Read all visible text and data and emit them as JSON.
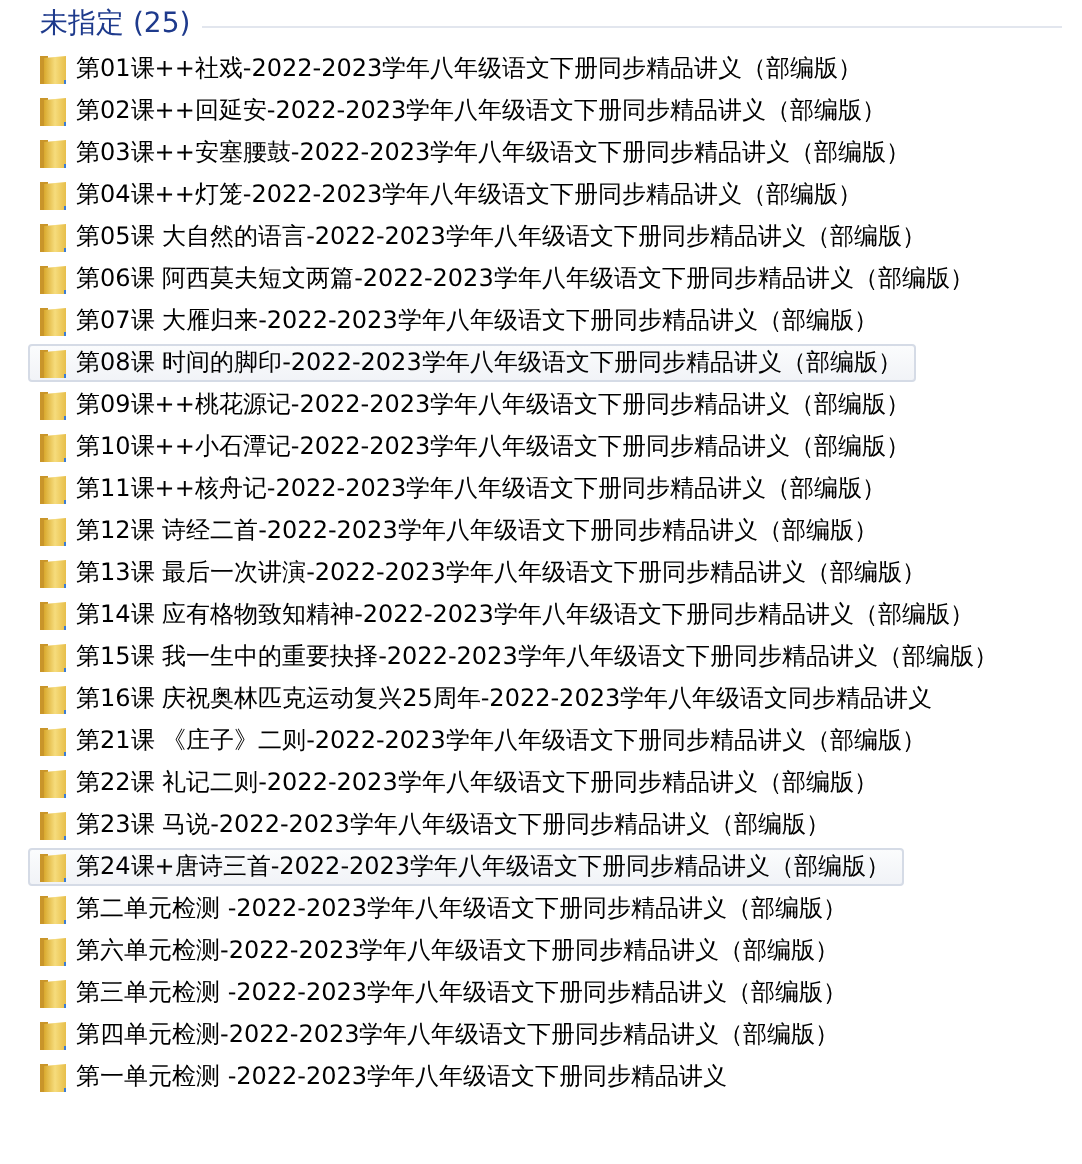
{
  "group": {
    "title": "未指定 (25)"
  },
  "items": [
    {
      "name": "第01课++社戏-2022-2023学年八年级语文下册同步精品讲义（部编版）",
      "selected": false
    },
    {
      "name": "第02课++回延安-2022-2023学年八年级语文下册同步精品讲义（部编版）",
      "selected": false
    },
    {
      "name": "第03课++安塞腰鼓-2022-2023学年八年级语文下册同步精品讲义（部编版）",
      "selected": false
    },
    {
      "name": "第04课++灯笼-2022-2023学年八年级语文下册同步精品讲义（部编版）",
      "selected": false
    },
    {
      "name": "第05课  大自然的语言-2022-2023学年八年级语文下册同步精品讲义（部编版）",
      "selected": false
    },
    {
      "name": "第06课  阿西莫夫短文两篇-2022-2023学年八年级语文下册同步精品讲义（部编版）",
      "selected": false
    },
    {
      "name": "第07课 大雁归来-2022-2023学年八年级语文下册同步精品讲义（部编版）",
      "selected": false
    },
    {
      "name": "第08课 时间的脚印-2022-2023学年八年级语文下册同步精品讲义（部编版）",
      "selected": true
    },
    {
      "name": "第09课++桃花源记-2022-2023学年八年级语文下册同步精品讲义（部编版）",
      "selected": false
    },
    {
      "name": "第10课++小石潭记-2022-2023学年八年级语文下册同步精品讲义（部编版）",
      "selected": false
    },
    {
      "name": "第11课++核舟记-2022-2023学年八年级语文下册同步精品讲义（部编版）",
      "selected": false
    },
    {
      "name": "第12课  诗经二首-2022-2023学年八年级语文下册同步精品讲义（部编版）",
      "selected": false
    },
    {
      "name": "第13课  最后一次讲演-2022-2023学年八年级语文下册同步精品讲义（部编版）",
      "selected": false
    },
    {
      "name": "第14课  应有格物致知精神-2022-2023学年八年级语文下册同步精品讲义（部编版）",
      "selected": false
    },
    {
      "name": "第15课 我一生中的重要抉择-2022-2023学年八年级语文下册同步精品讲义（部编版）",
      "selected": false
    },
    {
      "name": "第16课 庆祝奥林匹克运动复兴25周年-2022-2023学年八年级语文同步精品讲义",
      "selected": false
    },
    {
      "name": "第21课 《庄子》二则-2022-2023学年八年级语文下册同步精品讲义（部编版）",
      "selected": false
    },
    {
      "name": "第22课 礼记二则-2022-2023学年八年级语文下册同步精品讲义（部编版）",
      "selected": false
    },
    {
      "name": "第23课 马说-2022-2023学年八年级语文下册同步精品讲义（部编版）",
      "selected": false
    },
    {
      "name": "第24课+唐诗三首-2022-2023学年八年级语文下册同步精品讲义（部编版）",
      "selected": true
    },
    {
      "name": "第二单元检测 -2022-2023学年八年级语文下册同步精品讲义（部编版）",
      "selected": false
    },
    {
      "name": "第六单元检测-2022-2023学年八年级语文下册同步精品讲义（部编版）",
      "selected": false
    },
    {
      "name": "第三单元检测 -2022-2023学年八年级语文下册同步精品讲义（部编版）",
      "selected": false
    },
    {
      "name": "第四单元检测-2022-2023学年八年级语文下册同步精品讲义（部编版）",
      "selected": false
    },
    {
      "name": "第一单元检测 -2022-2023学年八年级语文下册同步精品讲义",
      "selected": false
    }
  ]
}
